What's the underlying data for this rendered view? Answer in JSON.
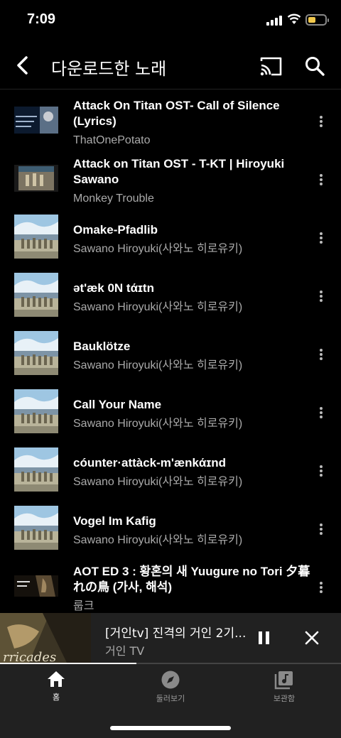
{
  "status_bar": {
    "time": "7:09"
  },
  "header": {
    "title": "다운로드한 노래"
  },
  "songs": [
    {
      "title": "Attack On Titan OST- Call of Silence (Lyrics)",
      "artist": "ThatOnePotato",
      "thumb": "call-of-silence"
    },
    {
      "title": "Attack on Titan OST - T-KT | Hiroyuki Sawano",
      "artist": "Monkey Trouble",
      "thumb": "wall-scene"
    },
    {
      "title": "Omake-Pfadlib",
      "artist": "Sawano Hiroyuki(사와노 히로유키)",
      "thumb": "album-art"
    },
    {
      "title": "ət'æk 0N tάɪtn",
      "artist": "Sawano Hiroyuki(사와노 히로유키)",
      "thumb": "album-art"
    },
    {
      "title": "Bauklötze",
      "artist": "Sawano Hiroyuki(사와노 히로유키)",
      "thumb": "album-art"
    },
    {
      "title": "Call Your Name",
      "artist": "Sawano Hiroyuki(사와노 히로유키)",
      "thumb": "album-art"
    },
    {
      "title": "cóunter·attàck-m'ænkάɪnd",
      "artist": "Sawano Hiroyuki(사와노 히로유키)",
      "thumb": "album-art"
    },
    {
      "title": "Vogel Im Kafig",
      "artist": "Sawano Hiroyuki(사와노 히로유키)",
      "thumb": "album-art"
    },
    {
      "title": "AOT ED 3 : 황혼의 새 Yuugure no Tori  夕暮れの鳥 (가사, 해석)",
      "artist": "룹크",
      "thumb": "ed3"
    }
  ],
  "mini_player": {
    "title": "[거인tv] 진격의 거인 2기...",
    "artist": "거인 TV",
    "progress": 0.4
  },
  "bottom_nav": [
    {
      "label": "홈",
      "icon": "home-icon",
      "active": true
    },
    {
      "label": "둘러보기",
      "icon": "compass-icon",
      "active": false
    },
    {
      "label": "보관함",
      "icon": "library-icon",
      "active": false
    }
  ],
  "colors": {
    "background": "#000000",
    "secondary_text": "#aaaaaa",
    "player_bg": "#212121",
    "battery": "#f2c94c"
  }
}
